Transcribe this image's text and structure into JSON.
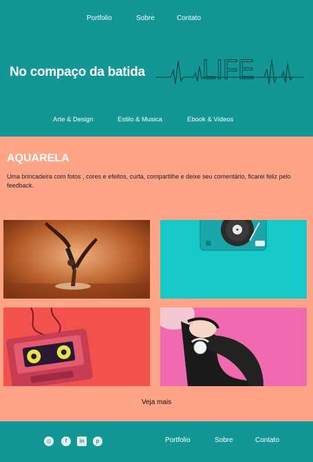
{
  "top_nav": {
    "items": [
      "Portfolio",
      "Sobre",
      "Contato"
    ]
  },
  "site": {
    "title": "No compaço da batida",
    "logo_text": "LIFE"
  },
  "category_nav": {
    "items": [
      "Arte & Design",
      "Estilo & Musica",
      "Ebook & Videos"
    ]
  },
  "section": {
    "title": "AQUARELA",
    "description": "Uma brincadeira com fotos , cores e efeitos, curta, compartilhe e deixe seu comentário, ficarei feliz pelo feedback."
  },
  "gallery": {
    "images": [
      "dancer-photo",
      "turntable-photo",
      "cassette-photo",
      "headphones-girl-photo"
    ]
  },
  "more_link": "Veja mais",
  "footer": {
    "social_icons": [
      "instagram-icon",
      "facebook-icon",
      "linkedin-icon",
      "pinterest-icon"
    ],
    "social_glyphs": [
      "◎",
      "f",
      "in",
      "p"
    ],
    "nav_items": [
      "Portfolio",
      "Sobre",
      "Contato"
    ]
  },
  "colors": {
    "teal": "#139696",
    "salmon": "#ffa487",
    "white": "#ffffff"
  }
}
